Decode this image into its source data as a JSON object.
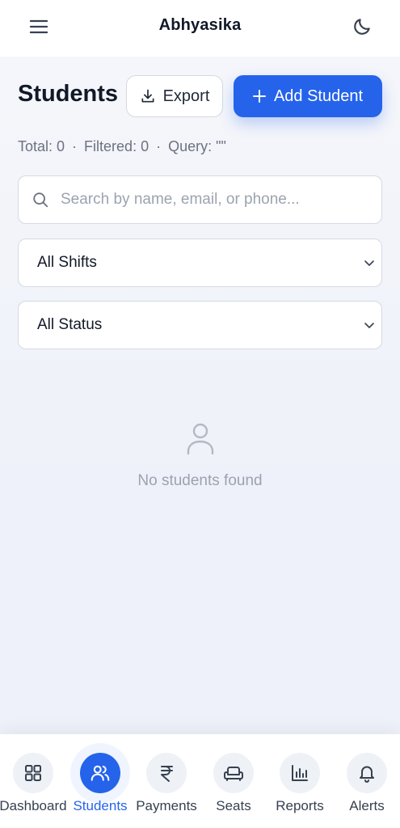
{
  "app": {
    "title": "Abhyasika"
  },
  "header": {
    "menu_icon": "hamburger-menu-icon",
    "theme_icon": "moon-icon"
  },
  "page": {
    "title": "Students",
    "export_label": "Export",
    "add_label": "Add Student"
  },
  "stats": {
    "total": "Total: 0",
    "separator": "·",
    "filtered": "Filtered: 0",
    "query": "Query: \"\""
  },
  "search": {
    "value": "",
    "placeholder": "Search by name, email, or phone..."
  },
  "filters": {
    "shift_selected": "All Shifts",
    "status_selected": "All Status"
  },
  "empty_state": {
    "icon": "user-icon",
    "message": "No students found"
  },
  "nav": {
    "active": "Students",
    "items": [
      {
        "label": "Dashboard",
        "icon": "dashboard-grid-icon"
      },
      {
        "label": "Students",
        "icon": "users-icon"
      },
      {
        "label": "Payments",
        "icon": "rupee-icon"
      },
      {
        "label": "Seats",
        "icon": "sofa-icon"
      },
      {
        "label": "Reports",
        "icon": "bar-chart-icon"
      },
      {
        "label": "Alerts",
        "icon": "bell-icon"
      }
    ]
  },
  "colors": {
    "accent": "#2563eb",
    "background": "#f3f5fa",
    "muted_text": "#6b7280"
  }
}
